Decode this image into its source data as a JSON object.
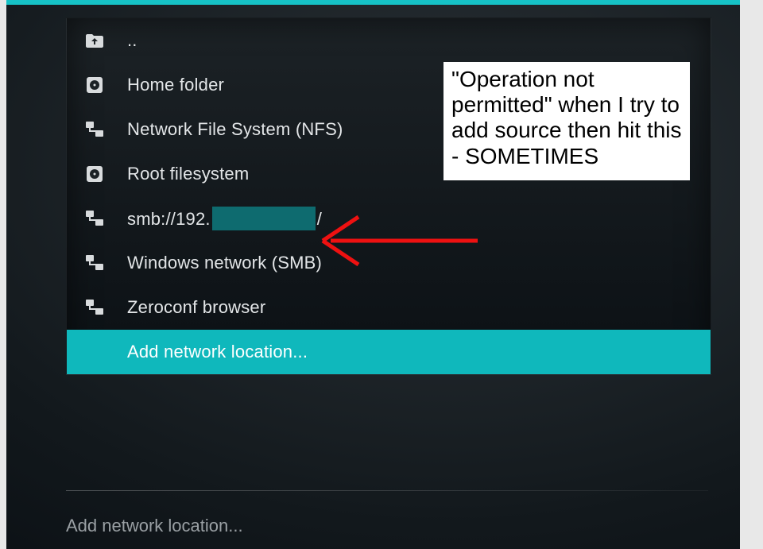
{
  "items": [
    {
      "icon": "folder-up-icon",
      "label": ".."
    },
    {
      "icon": "disk-icon",
      "label": "Home folder"
    },
    {
      "icon": "network-icon",
      "label": "Network File System (NFS)"
    },
    {
      "icon": "disk-icon",
      "label": "Root filesystem"
    },
    {
      "icon": "network-icon",
      "label_prefix": "smb://192.",
      "label_suffix": "/",
      "redacted": true
    },
    {
      "icon": "network-icon",
      "label": "Windows network (SMB)"
    },
    {
      "icon": "network-icon",
      "label": "Zeroconf browser"
    },
    {
      "icon": null,
      "label": "Add network location...",
      "selected": true
    }
  ],
  "status_text": "Add network location...",
  "annotation_text": "\"Operation not permitted\" when I try to add source then hit this - SOMETIMES"
}
